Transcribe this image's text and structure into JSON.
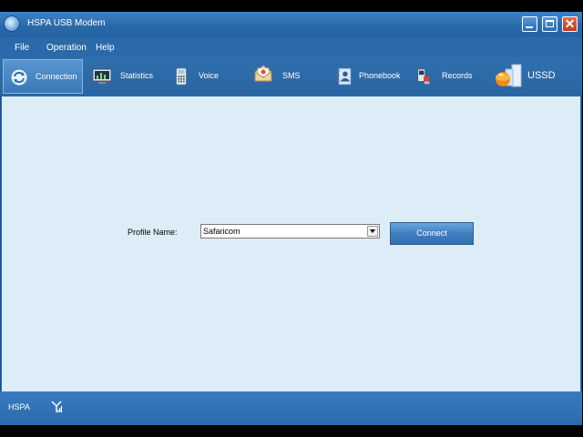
{
  "window": {
    "title": "HSPA USB Modem",
    "controls": {
      "minimize": "minimize",
      "maximize": "maximize",
      "close": "✕"
    }
  },
  "menu": [
    "File",
    "Operation",
    "Help"
  ],
  "toolbar": [
    {
      "label": "Connection",
      "icon": "connection-icon",
      "active": true
    },
    {
      "label": "Statistics",
      "icon": "statistics-icon",
      "active": false
    },
    {
      "label": "Voice",
      "icon": "voice-icon",
      "active": false
    },
    {
      "label": "SMS",
      "icon": "sms-icon",
      "active": false
    },
    {
      "label": "Phonebook",
      "icon": "phonebook-icon",
      "active": false
    },
    {
      "label": "Records",
      "icon": "records-icon",
      "active": false
    },
    {
      "label": "USSD",
      "icon": "ussd-icon",
      "active": false
    }
  ],
  "connection": {
    "profile_label": "Profile Name:",
    "profile_value": "Safaricom",
    "connect_label": "Connect"
  },
  "status": {
    "network": "HSPA",
    "signal_icon": "signal-icon"
  },
  "colors": {
    "chrome": "#2b6aaa",
    "content": "#dcedf7",
    "button": "#3f7fc1"
  }
}
